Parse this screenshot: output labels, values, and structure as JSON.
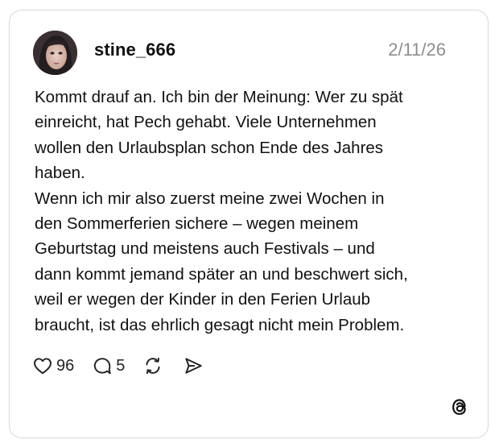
{
  "post": {
    "username": "stine_666",
    "date": "2/11/26",
    "avatar_icon": "user-avatar-photo",
    "body_lines": [
      "Kommt drauf an. Ich bin der Meinung: Wer zu spät",
      "einreicht, hat Pech gehabt. Viele Unternehmen",
      "wollen den Urlaubsplan schon Ende des Jahres",
      "haben.",
      "Wenn ich mir also zuerst meine zwei Wochen in",
      "den Sommerferien sichere – wegen meinem",
      "Geburtstag und meistens auch Festivals – und",
      "dann kommt jemand später an und beschwert sich,",
      "weil er wegen der Kinder in den Ferien Urlaub",
      "braucht, ist das ehrlich gesagt nicht mein Problem."
    ],
    "actions": {
      "likes": "96",
      "replies": "5",
      "like_icon": "heart-icon",
      "reply_icon": "comment-icon",
      "repost_icon": "repost-icon",
      "share_icon": "send-icon"
    },
    "brand_icon": "threads-logo-icon"
  },
  "colors": {
    "text": "#111111",
    "muted": "#8e8e8e",
    "border": "#d9d9d9",
    "background": "#ffffff"
  }
}
